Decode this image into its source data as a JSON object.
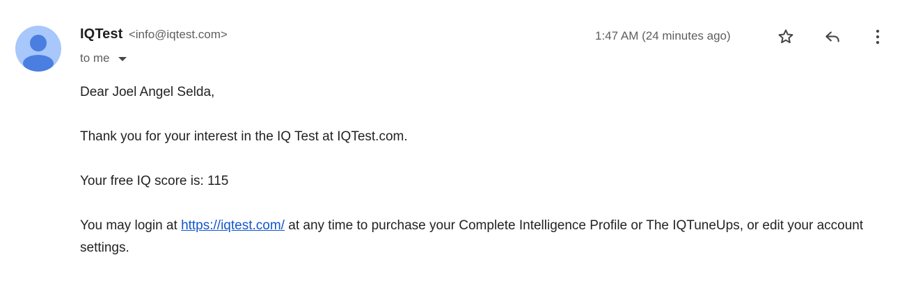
{
  "sender": {
    "name": "IQTest",
    "email": "<info@iqtest.com>"
  },
  "recipient": {
    "label": "to me"
  },
  "timestamp": "1:47 AM (24 minutes ago)",
  "actions": {
    "star_icon": "star-outline",
    "reply_icon": "reply-arrow",
    "more_icon": "vertical-dots"
  },
  "body": {
    "greeting": "Dear Joel Angel Selda,",
    "para1": "Thank you for your interest in the IQ Test at IQTest.com.",
    "para2": "Your free IQ score is: 115",
    "para3_before": "You may login at ",
    "para3_link": "https://iqtest.com/",
    "para3_after": " at any time to purchase your Complete Intelligence Profile or The IQTuneUps, or edit your account settings."
  },
  "colors": {
    "avatar_bg": "#a8c7fa",
    "avatar_fg": "#4a7ee0",
    "link": "#1155cc"
  }
}
